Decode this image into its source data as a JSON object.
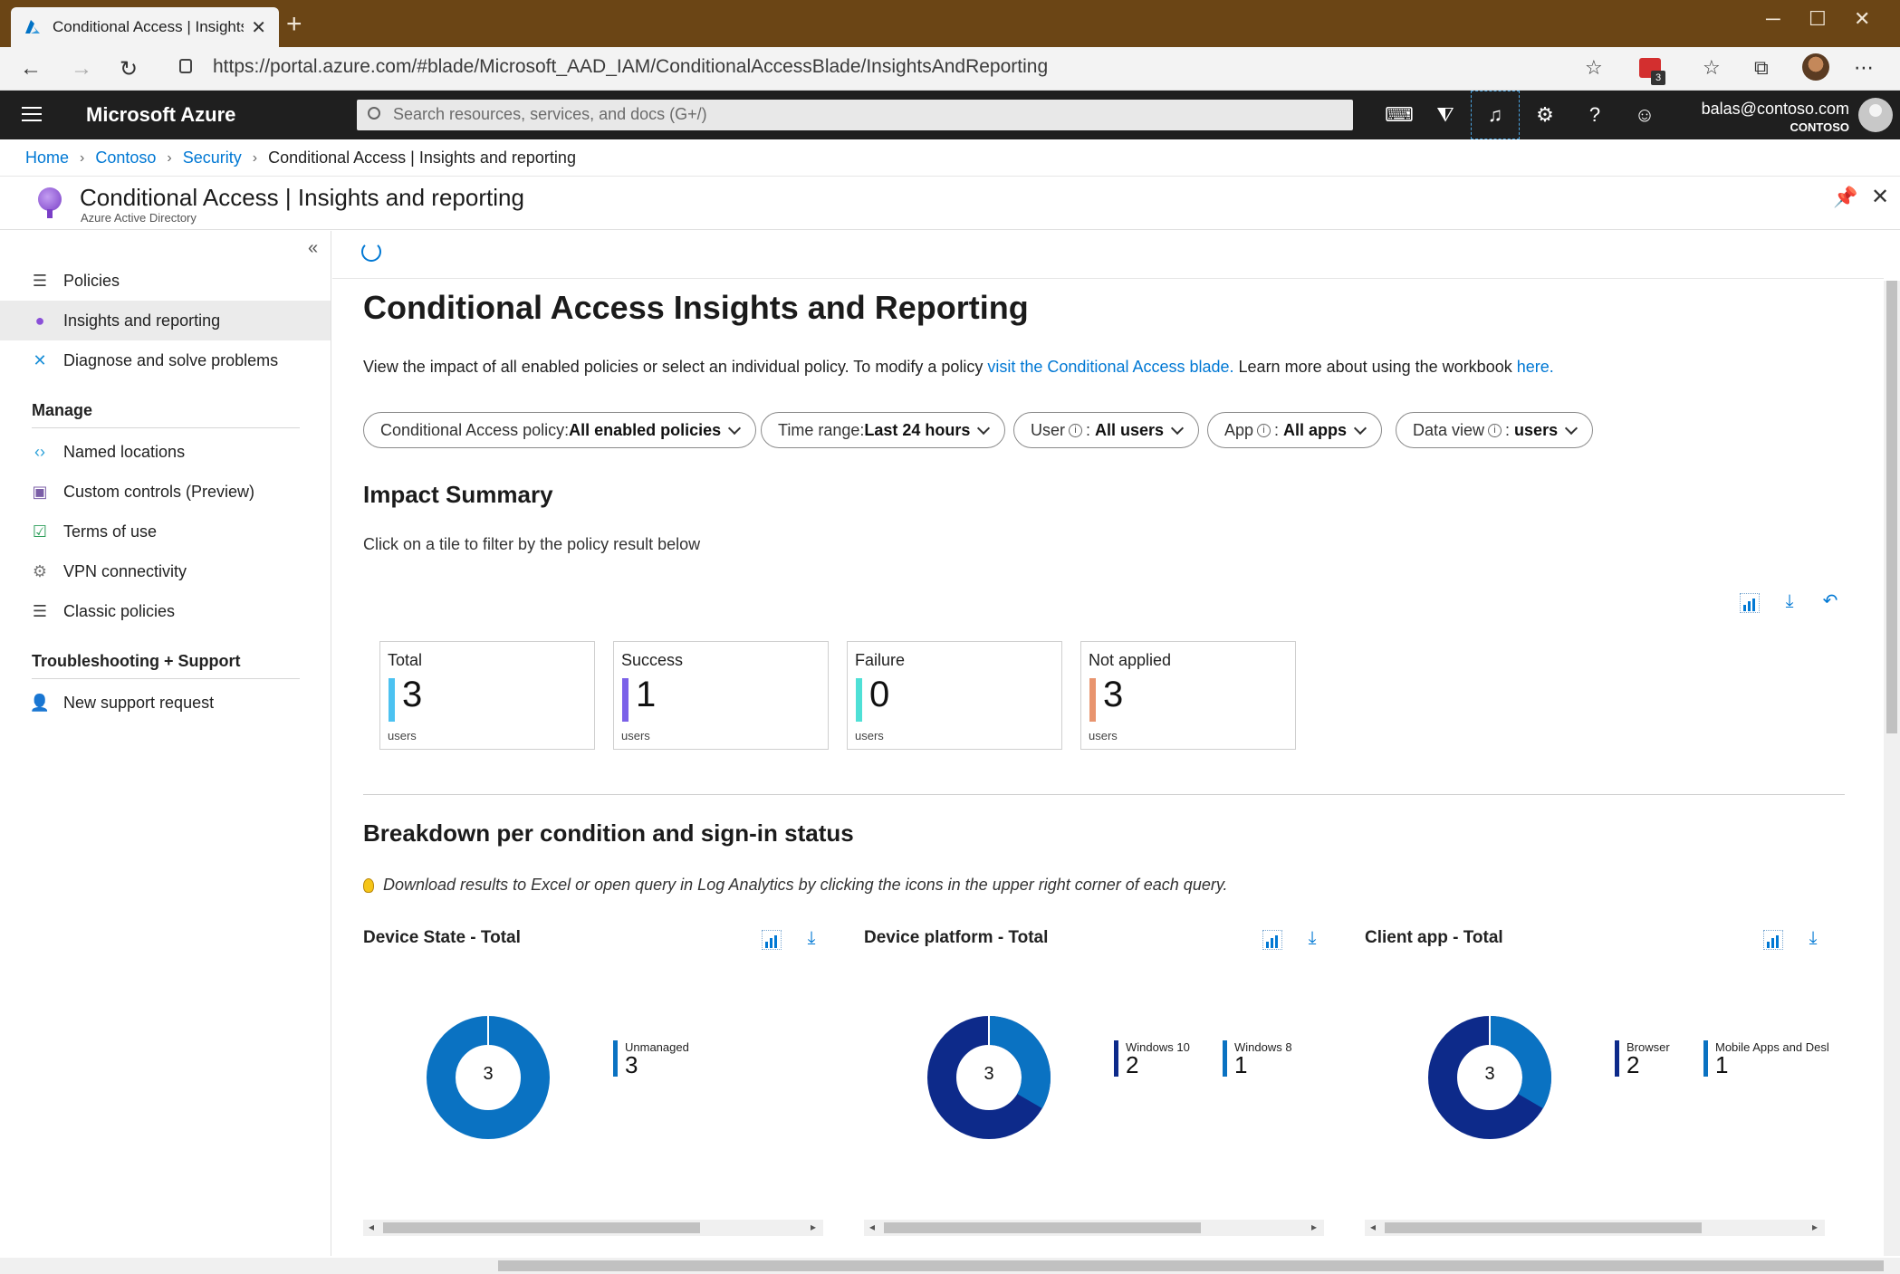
{
  "browser": {
    "tab_title": "Conditional Access | Insights and",
    "url": "https://portal.azure.com/#blade/Microsoft_AAD_IAM/ConditionalAccessBlade/InsightsAndReporting",
    "ext_badge": "3"
  },
  "azure": {
    "brand": "Microsoft Azure",
    "search_placeholder": "Search resources, services, and docs (G+/)",
    "account_email": "balas@contoso.com",
    "account_org": "CONTOSO"
  },
  "breadcrumb": [
    "Home",
    "Contoso",
    "Security",
    "Conditional Access | Insights and reporting"
  ],
  "blade": {
    "title": "Conditional Access | Insights and reporting",
    "subtitle": "Azure Active Directory"
  },
  "nav": {
    "items": [
      "Policies",
      "Insights and reporting",
      "Diagnose and solve problems"
    ],
    "manage_header": "Manage",
    "manage_items": [
      "Named locations",
      "Custom controls (Preview)",
      "Terms of use",
      "VPN connectivity",
      "Classic policies"
    ],
    "support_header": "Troubleshooting + Support",
    "support_items": [
      "New support request"
    ]
  },
  "main": {
    "heading": "Conditional Access Insights and Reporting",
    "desc_prefix": "View the impact of all enabled policies or select an individual policy. To modify a policy ",
    "desc_link1": "visit the Conditional Access blade.",
    "desc_mid": " Learn more about using the workbook ",
    "desc_link2": "here.",
    "filters": {
      "policy_label": "Conditional Access policy: ",
      "policy_value": "All enabled policies",
      "time_label": "Time range: ",
      "time_value": "Last 24 hours",
      "user_label": "User",
      "user_value": "All users",
      "app_label": "App",
      "app_value": "All apps",
      "dataview_label": "Data view",
      "dataview_value": "users"
    },
    "impact_heading": "Impact Summary",
    "impact_hint": "Click on a tile to filter by the policy result below",
    "tiles": [
      {
        "label": "Total",
        "value": "3",
        "unit": "users",
        "color": "#4cc2f1"
      },
      {
        "label": "Success",
        "value": "1",
        "unit": "users",
        "color": "#7b61e8"
      },
      {
        "label": "Failure",
        "value": "0",
        "unit": "users",
        "color": "#4fe0d6"
      },
      {
        "label": "Not applied",
        "value": "3",
        "unit": "users",
        "color": "#e8946e"
      }
    ],
    "breakdown_heading": "Breakdown per condition and sign-in status",
    "breakdown_tip": "Download results to Excel or open query in Log Analytics by clicking the icons in the upper right corner of each query.",
    "panels": [
      {
        "title": "Device State - Total",
        "total": "3",
        "legend": [
          {
            "name": "Unmanaged",
            "value": "3",
            "color": "#0a72c2"
          }
        ]
      },
      {
        "title": "Device platform - Total",
        "total": "3",
        "legend": [
          {
            "name": "Windows 10",
            "value": "2",
            "color": "#0d2a8a"
          },
          {
            "name": "Windows 8",
            "value": "1",
            "color": "#0a72c2"
          }
        ]
      },
      {
        "title": "Client app - Total",
        "total": "3",
        "legend": [
          {
            "name": "Browser",
            "value": "2",
            "color": "#0d2a8a"
          },
          {
            "name": "Mobile Apps and Desl",
            "value": "1",
            "color": "#0a72c2"
          }
        ]
      }
    ]
  }
}
